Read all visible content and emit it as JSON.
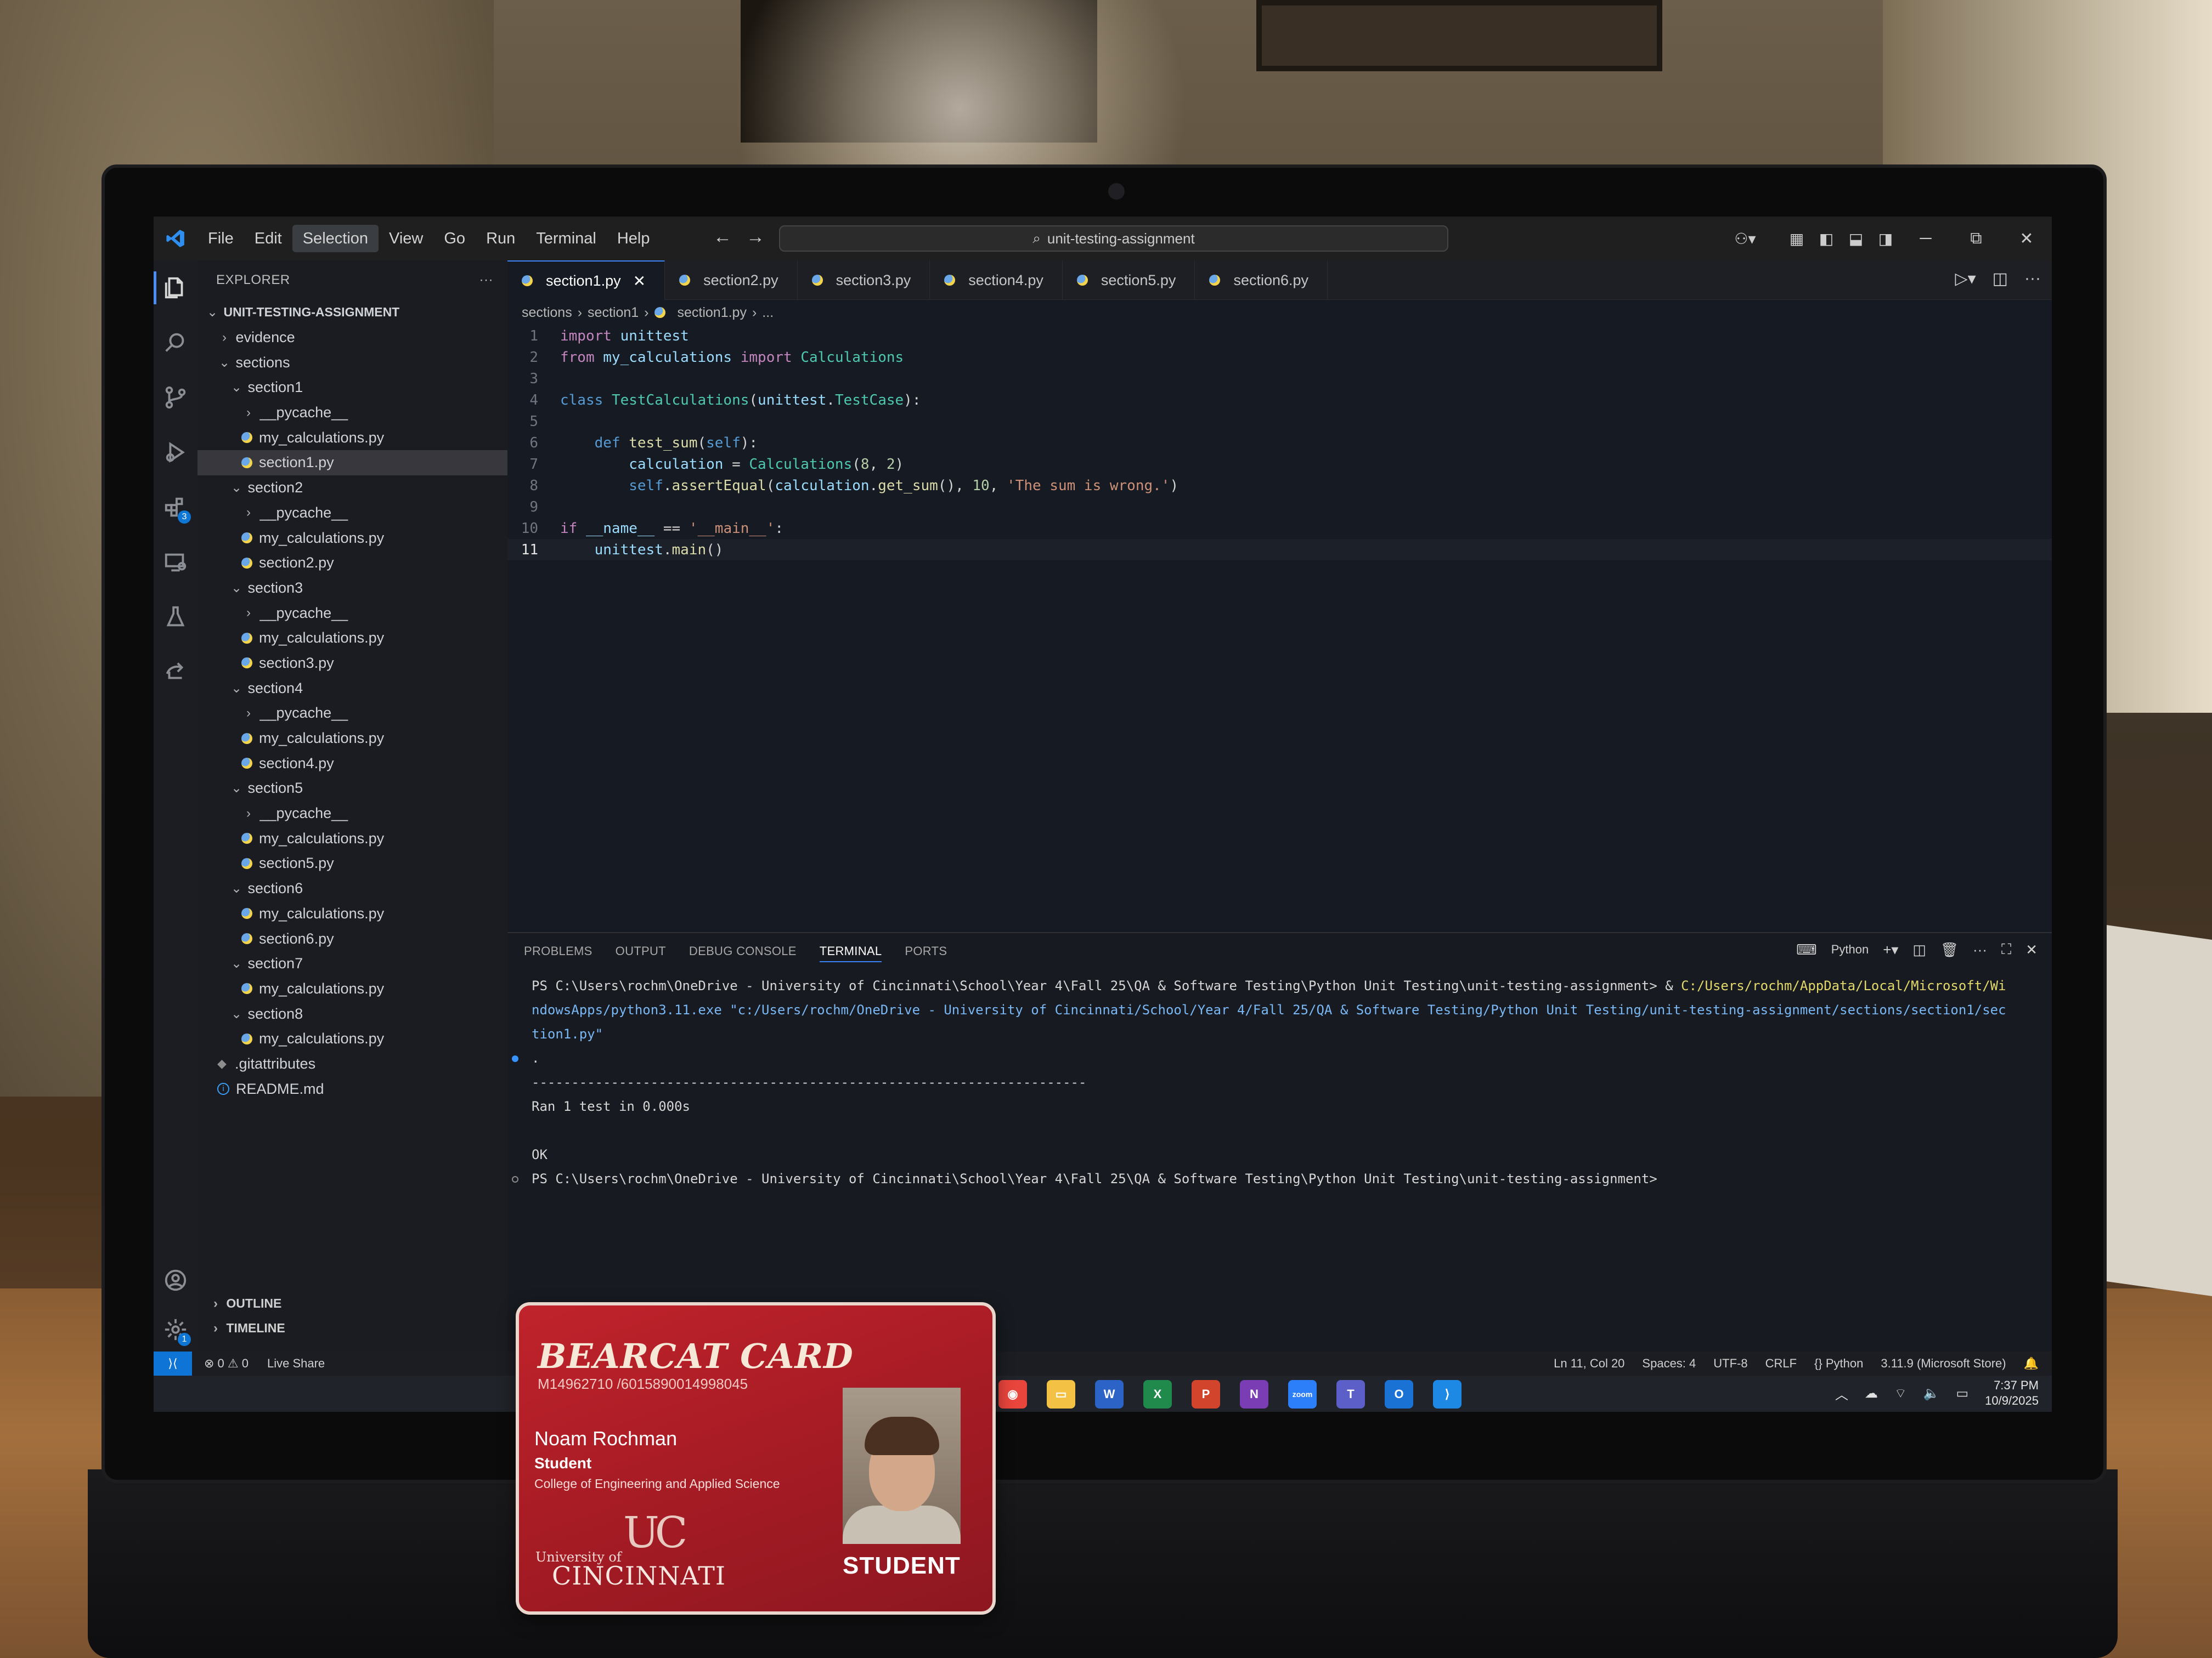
{
  "titlebar": {
    "menu": [
      "File",
      "Edit",
      "Selection",
      "View",
      "Go",
      "Run",
      "Terminal",
      "Help"
    ],
    "search_text": "unit-testing-assignment",
    "nav_back": "←",
    "nav_forward": "→"
  },
  "activity_bar": {
    "items": [
      "files-icon",
      "search-icon",
      "source-control-icon",
      "run-debug-icon",
      "extensions-icon",
      "remote-explorer-icon",
      "testing-icon",
      "live-share-icon"
    ],
    "extensions_badge": "3",
    "settings_badge": "1"
  },
  "sidebar": {
    "header": "EXPLORER",
    "more": "···",
    "tree": [
      {
        "label": "UNIT-TESTING-ASSIGNMENT",
        "depth": 0,
        "kind": "root",
        "open": true
      },
      {
        "label": "evidence",
        "depth": 1,
        "kind": "folder",
        "open": false
      },
      {
        "label": "sections",
        "depth": 1,
        "kind": "folder",
        "open": true
      },
      {
        "label": "section1",
        "depth": 2,
        "kind": "folder",
        "open": true
      },
      {
        "label": "__pycache__",
        "depth": 3,
        "kind": "folder",
        "open": false
      },
      {
        "label": "my_calculations.py",
        "depth": 3,
        "kind": "py"
      },
      {
        "label": "section1.py",
        "depth": 3,
        "kind": "py",
        "selected": true
      },
      {
        "label": "section2",
        "depth": 2,
        "kind": "folder",
        "open": true
      },
      {
        "label": "__pycache__",
        "depth": 3,
        "kind": "folder",
        "open": false
      },
      {
        "label": "my_calculations.py",
        "depth": 3,
        "kind": "py"
      },
      {
        "label": "section2.py",
        "depth": 3,
        "kind": "py"
      },
      {
        "label": "section3",
        "depth": 2,
        "kind": "folder",
        "open": true
      },
      {
        "label": "__pycache__",
        "depth": 3,
        "kind": "folder",
        "open": false
      },
      {
        "label": "my_calculations.py",
        "depth": 3,
        "kind": "py"
      },
      {
        "label": "section3.py",
        "depth": 3,
        "kind": "py"
      },
      {
        "label": "section4",
        "depth": 2,
        "kind": "folder",
        "open": true
      },
      {
        "label": "__pycache__",
        "depth": 3,
        "kind": "folder",
        "open": false
      },
      {
        "label": "my_calculations.py",
        "depth": 3,
        "kind": "py"
      },
      {
        "label": "section4.py",
        "depth": 3,
        "kind": "py"
      },
      {
        "label": "section5",
        "depth": 2,
        "kind": "folder",
        "open": true
      },
      {
        "label": "__pycache__",
        "depth": 3,
        "kind": "folder",
        "open": false
      },
      {
        "label": "my_calculations.py",
        "depth": 3,
        "kind": "py"
      },
      {
        "label": "section5.py",
        "depth": 3,
        "kind": "py"
      },
      {
        "label": "section6",
        "depth": 2,
        "kind": "folder",
        "open": true
      },
      {
        "label": "my_calculations.py",
        "depth": 3,
        "kind": "py"
      },
      {
        "label": "section6.py",
        "depth": 3,
        "kind": "py"
      },
      {
        "label": "section7",
        "depth": 2,
        "kind": "folder",
        "open": true
      },
      {
        "label": "my_calculations.py",
        "depth": 3,
        "kind": "py"
      },
      {
        "label": "section8",
        "depth": 2,
        "kind": "folder",
        "open": true
      },
      {
        "label": "my_calculations.py",
        "depth": 3,
        "kind": "py"
      },
      {
        "label": ".gitattributes",
        "depth": 1,
        "kind": "git"
      },
      {
        "label": "README.md",
        "depth": 1,
        "kind": "info"
      }
    ],
    "outline": "OUTLINE",
    "timeline": "TIMELINE"
  },
  "editor": {
    "tabs": [
      {
        "label": "section1.py",
        "active": true
      },
      {
        "label": "section2.py"
      },
      {
        "label": "section3.py"
      },
      {
        "label": "section4.py"
      },
      {
        "label": "section5.py"
      },
      {
        "label": "section6.py"
      }
    ],
    "breadcrumb": [
      "sections",
      "section1",
      "section1.py",
      "..."
    ],
    "lines": [
      "import unittest",
      "from my_calculations import Calculations",
      "",
      "class TestCalculations(unittest.TestCase):",
      "",
      "    def test_sum(self):",
      "        calculation = Calculations(8, 2)",
      "        self.assertEqual(calculation.get_sum(), 10, 'The sum is wrong.')",
      "",
      "if __name__ == '__main__':",
      "    unittest.main()"
    ],
    "current_line": 11
  },
  "panel": {
    "tabs": [
      "PROBLEMS",
      "OUTPUT",
      "DEBUG CONSOLE",
      "TERMINAL",
      "PORTS"
    ],
    "active_tab": "TERMINAL",
    "shell_label": "Python",
    "terminal": [
      {
        "prompt": "PS C:\\Users\\rochm\\OneDrive - University of Cincinnati\\School\\Year 4\\Fall 25\\QA & Software Testing\\Python Unit Testing\\unit-testing-assignment> & ",
        "cmd": "C:/Users/rochm/AppData/Local/Microsoft/Wi"
      },
      {
        "prompt": "",
        "cmd": "ndowsApps/python3.11.exe \"c:/Users/rochm/OneDrive - University of Cincinnati/School/Year 4/Fall 25/QA & Software Testing/Python Unit Testing/unit-testing-assignment/sections/section1/sec"
      },
      {
        "prompt": "",
        "cmd": "tion1.py\""
      },
      {
        "prompt": ".",
        "cmd": "",
        "marker": "blue"
      },
      {
        "prompt": "----------------------------------------------------------------------",
        "cmd": ""
      },
      {
        "prompt": "Ran 1 test in 0.000s",
        "cmd": ""
      },
      {
        "prompt": "",
        "cmd": ""
      },
      {
        "prompt": "OK",
        "cmd": ""
      },
      {
        "prompt": "PS C:\\Users\\rochm\\OneDrive - University of Cincinnati\\School\\Year 4\\Fall 25\\QA & Software Testing\\Python Unit Testing\\unit-testing-assignment>",
        "cmd": "",
        "marker": "hollow"
      }
    ]
  },
  "statusbar": {
    "problems": "⊗ 0 ⚠ 0",
    "live_share": "Live Share",
    "position": "Ln 11, Col 20",
    "spaces": "Spaces: 4",
    "encoding": "UTF-8",
    "eol": "CRLF",
    "language": "{} Python",
    "interpreter": "3.11.9 (Microsoft Store)"
  },
  "taskbar": {
    "time": "7:37 PM",
    "date": "10/9/2025",
    "apps": [
      {
        "name": "chrome-icon",
        "color": "#e8453c",
        "glyph": "◉"
      },
      {
        "name": "file-explorer-icon",
        "color": "#f3c244",
        "glyph": "▭"
      },
      {
        "name": "word-icon",
        "color": "#2b63c6",
        "glyph": "W"
      },
      {
        "name": "excel-icon",
        "color": "#1f8a4c",
        "glyph": "X"
      },
      {
        "name": "powerpoint-icon",
        "color": "#d2452c",
        "glyph": "P"
      },
      {
        "name": "onenote-icon",
        "color": "#7b3db3",
        "glyph": "N"
      },
      {
        "name": "zoom-icon",
        "color": "#2d7ff9",
        "glyph": "zoom"
      },
      {
        "name": "teams-icon",
        "color": "#5b5fc7",
        "glyph": "T"
      },
      {
        "name": "outlook-icon",
        "color": "#1a73d4",
        "glyph": "O"
      },
      {
        "name": "vscode-icon",
        "color": "#1e88e5",
        "glyph": "⟩"
      }
    ]
  },
  "id_card": {
    "title": "BEARCAT CARD",
    "number": "M14962710 /6015890014998045",
    "name": "Noam Rochman",
    "role": "Student",
    "college": "College of Engineering and Applied Science",
    "uc_mark": "UC",
    "university_line1": "University of",
    "university_line2": "CINCINNATI",
    "badge": "STUDENT"
  }
}
